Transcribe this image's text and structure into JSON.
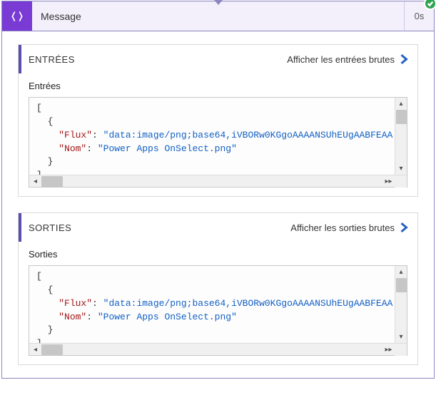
{
  "header": {
    "title": "Message",
    "duration": "0s"
  },
  "inputs": {
    "heading": "ENTRÉES",
    "raw_link": "Afficher les entrées brutes",
    "sub": "Entrées",
    "row": {
      "flux_key": "\"Flux\"",
      "flux_val": "\"data:image/png;base64,iVBORw0KGgoAAAANSUhEUgAABFEAA",
      "nom_key": "\"Nom\"",
      "nom_val": "\"Power Apps OnSelect.png\""
    }
  },
  "outputs": {
    "heading": "SORTIES",
    "raw_link": "Afficher les sorties brutes",
    "sub": "Sorties",
    "row": {
      "flux_key": "\"Flux\"",
      "flux_val": "\"data:image/png;base64,iVBORw0KGgoAAAANSUhEUgAABFEAA",
      "nom_key": "\"Nom\"",
      "nom_val": "\"Power Apps OnSelect.png\""
    }
  }
}
